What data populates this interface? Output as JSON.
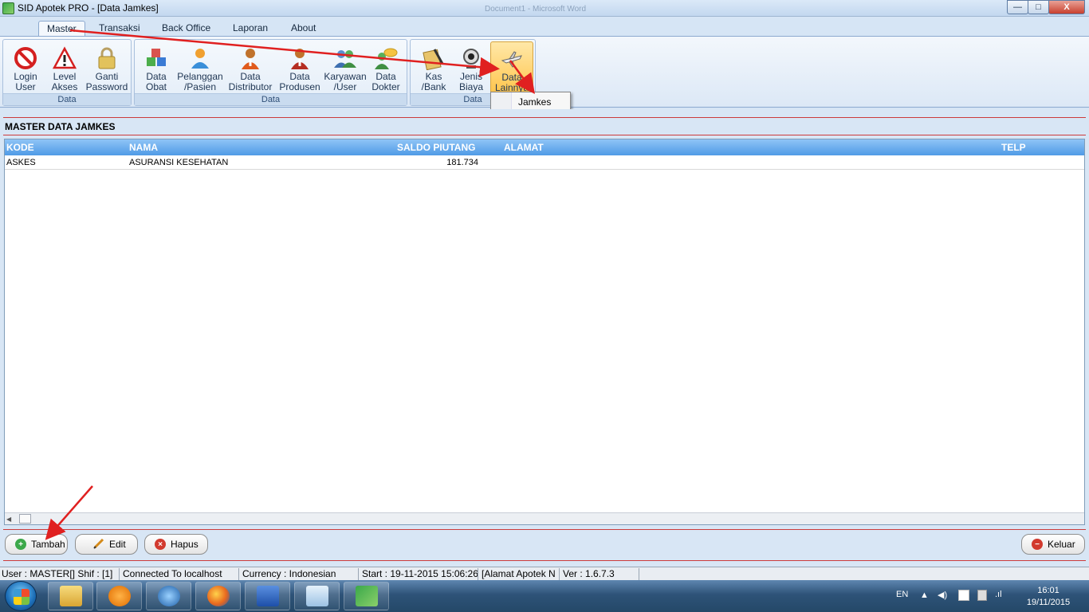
{
  "window": {
    "title": "SID Apotek PRO - [Data Jamkes]",
    "background_title": "Document1 - Microsoft Word",
    "controls": {
      "minimize": "—",
      "maximize": "□",
      "close": "X"
    }
  },
  "tabs": [
    {
      "label": "Master",
      "active": true
    },
    {
      "label": "Transaksi"
    },
    {
      "label": "Back Office"
    },
    {
      "label": "Laporan"
    },
    {
      "label": "About"
    }
  ],
  "ribbon": {
    "groups": [
      {
        "label": "Data",
        "buttons": [
          {
            "label": "Login\nUser",
            "icon": "no-entry-icon"
          },
          {
            "label": "Level\nAkses",
            "icon": "warning-icon"
          },
          {
            "label": "Ganti\nPassword",
            "icon": "lock-icon"
          }
        ]
      },
      {
        "label": "Data",
        "buttons": [
          {
            "label": "Data\nObat",
            "icon": "medicine-cubes-icon"
          },
          {
            "label": "Pelanggan\n/Pasien",
            "icon": "customer-icon"
          },
          {
            "label": "Data\nDistributor",
            "icon": "distributor-person-icon"
          },
          {
            "label": "Data\nProdusen",
            "icon": "producer-person-icon"
          },
          {
            "label": "Karyawan\n/User",
            "icon": "employees-icon"
          },
          {
            "label": "Data\nDokter",
            "icon": "doctor-chat-icon"
          }
        ]
      },
      {
        "label": "Data",
        "buttons": [
          {
            "label": "Kas\n/Bank",
            "icon": "notebook-pen-icon"
          },
          {
            "label": "Jenis\nBiaya",
            "icon": "webcam-icon"
          },
          {
            "label": "Data\nLainnya",
            "icon": "airplane-icon",
            "highlighted": true
          }
        ]
      }
    ],
    "dropdown": {
      "items": [
        "Jamkes"
      ]
    }
  },
  "main": {
    "section_title": "MASTER DATA JAMKES",
    "table": {
      "columns": [
        "KODE",
        "NAMA",
        "SALDO PIUTANG",
        "ALAMAT",
        "TELP"
      ],
      "rows": [
        {
          "kode": "ASKES",
          "nama": "ASURANSI KESEHATAN",
          "saldo": "181.734",
          "alamat": "",
          "telp": ""
        }
      ]
    },
    "buttons": {
      "add": "Tambah",
      "edit": "Edit",
      "delete": "Hapus",
      "exit": "Keluar"
    }
  },
  "statusbar": {
    "user": "User : MASTER[] Shif : [1]",
    "connection": "Connected To localhost",
    "currency": "Currency : Indonesian",
    "start": "Start  : 19-11-2015 15:06:26",
    "address": "[Alamat Apotek  N",
    "version": "Ver : 1.6.7.3"
  },
  "taskbar": {
    "language": "EN",
    "time": "16:01",
    "date": "19/11/2015"
  },
  "colors": {
    "grid_header": "#4f9be6",
    "accent_red": "#e02020",
    "ribbon_highlight": "#ffc54d"
  }
}
